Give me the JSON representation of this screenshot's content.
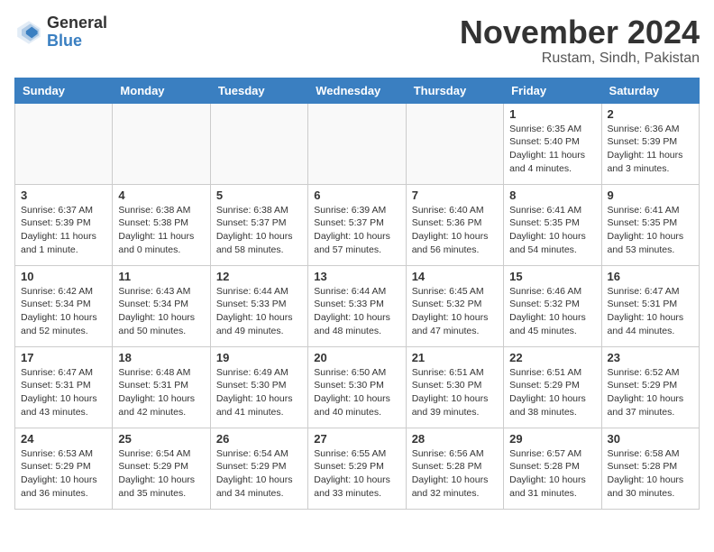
{
  "logo": {
    "general": "General",
    "blue": "Blue"
  },
  "title": "November 2024",
  "location": "Rustam, Sindh, Pakistan",
  "days_of_week": [
    "Sunday",
    "Monday",
    "Tuesday",
    "Wednesday",
    "Thursday",
    "Friday",
    "Saturday"
  ],
  "weeks": [
    [
      {
        "day": "",
        "info": ""
      },
      {
        "day": "",
        "info": ""
      },
      {
        "day": "",
        "info": ""
      },
      {
        "day": "",
        "info": ""
      },
      {
        "day": "",
        "info": ""
      },
      {
        "day": "1",
        "info": "Sunrise: 6:35 AM\nSunset: 5:40 PM\nDaylight: 11 hours and 4 minutes."
      },
      {
        "day": "2",
        "info": "Sunrise: 6:36 AM\nSunset: 5:39 PM\nDaylight: 11 hours and 3 minutes."
      }
    ],
    [
      {
        "day": "3",
        "info": "Sunrise: 6:37 AM\nSunset: 5:39 PM\nDaylight: 11 hours and 1 minute."
      },
      {
        "day": "4",
        "info": "Sunrise: 6:38 AM\nSunset: 5:38 PM\nDaylight: 11 hours and 0 minutes."
      },
      {
        "day": "5",
        "info": "Sunrise: 6:38 AM\nSunset: 5:37 PM\nDaylight: 10 hours and 58 minutes."
      },
      {
        "day": "6",
        "info": "Sunrise: 6:39 AM\nSunset: 5:37 PM\nDaylight: 10 hours and 57 minutes."
      },
      {
        "day": "7",
        "info": "Sunrise: 6:40 AM\nSunset: 5:36 PM\nDaylight: 10 hours and 56 minutes."
      },
      {
        "day": "8",
        "info": "Sunrise: 6:41 AM\nSunset: 5:35 PM\nDaylight: 10 hours and 54 minutes."
      },
      {
        "day": "9",
        "info": "Sunrise: 6:41 AM\nSunset: 5:35 PM\nDaylight: 10 hours and 53 minutes."
      }
    ],
    [
      {
        "day": "10",
        "info": "Sunrise: 6:42 AM\nSunset: 5:34 PM\nDaylight: 10 hours and 52 minutes."
      },
      {
        "day": "11",
        "info": "Sunrise: 6:43 AM\nSunset: 5:34 PM\nDaylight: 10 hours and 50 minutes."
      },
      {
        "day": "12",
        "info": "Sunrise: 6:44 AM\nSunset: 5:33 PM\nDaylight: 10 hours and 49 minutes."
      },
      {
        "day": "13",
        "info": "Sunrise: 6:44 AM\nSunset: 5:33 PM\nDaylight: 10 hours and 48 minutes."
      },
      {
        "day": "14",
        "info": "Sunrise: 6:45 AM\nSunset: 5:32 PM\nDaylight: 10 hours and 47 minutes."
      },
      {
        "day": "15",
        "info": "Sunrise: 6:46 AM\nSunset: 5:32 PM\nDaylight: 10 hours and 45 minutes."
      },
      {
        "day": "16",
        "info": "Sunrise: 6:47 AM\nSunset: 5:31 PM\nDaylight: 10 hours and 44 minutes."
      }
    ],
    [
      {
        "day": "17",
        "info": "Sunrise: 6:47 AM\nSunset: 5:31 PM\nDaylight: 10 hours and 43 minutes."
      },
      {
        "day": "18",
        "info": "Sunrise: 6:48 AM\nSunset: 5:31 PM\nDaylight: 10 hours and 42 minutes."
      },
      {
        "day": "19",
        "info": "Sunrise: 6:49 AM\nSunset: 5:30 PM\nDaylight: 10 hours and 41 minutes."
      },
      {
        "day": "20",
        "info": "Sunrise: 6:50 AM\nSunset: 5:30 PM\nDaylight: 10 hours and 40 minutes."
      },
      {
        "day": "21",
        "info": "Sunrise: 6:51 AM\nSunset: 5:30 PM\nDaylight: 10 hours and 39 minutes."
      },
      {
        "day": "22",
        "info": "Sunrise: 6:51 AM\nSunset: 5:29 PM\nDaylight: 10 hours and 38 minutes."
      },
      {
        "day": "23",
        "info": "Sunrise: 6:52 AM\nSunset: 5:29 PM\nDaylight: 10 hours and 37 minutes."
      }
    ],
    [
      {
        "day": "24",
        "info": "Sunrise: 6:53 AM\nSunset: 5:29 PM\nDaylight: 10 hours and 36 minutes."
      },
      {
        "day": "25",
        "info": "Sunrise: 6:54 AM\nSunset: 5:29 PM\nDaylight: 10 hours and 35 minutes."
      },
      {
        "day": "26",
        "info": "Sunrise: 6:54 AM\nSunset: 5:29 PM\nDaylight: 10 hours and 34 minutes."
      },
      {
        "day": "27",
        "info": "Sunrise: 6:55 AM\nSunset: 5:29 PM\nDaylight: 10 hours and 33 minutes."
      },
      {
        "day": "28",
        "info": "Sunrise: 6:56 AM\nSunset: 5:28 PM\nDaylight: 10 hours and 32 minutes."
      },
      {
        "day": "29",
        "info": "Sunrise: 6:57 AM\nSunset: 5:28 PM\nDaylight: 10 hours and 31 minutes."
      },
      {
        "day": "30",
        "info": "Sunrise: 6:58 AM\nSunset: 5:28 PM\nDaylight: 10 hours and 30 minutes."
      }
    ]
  ]
}
